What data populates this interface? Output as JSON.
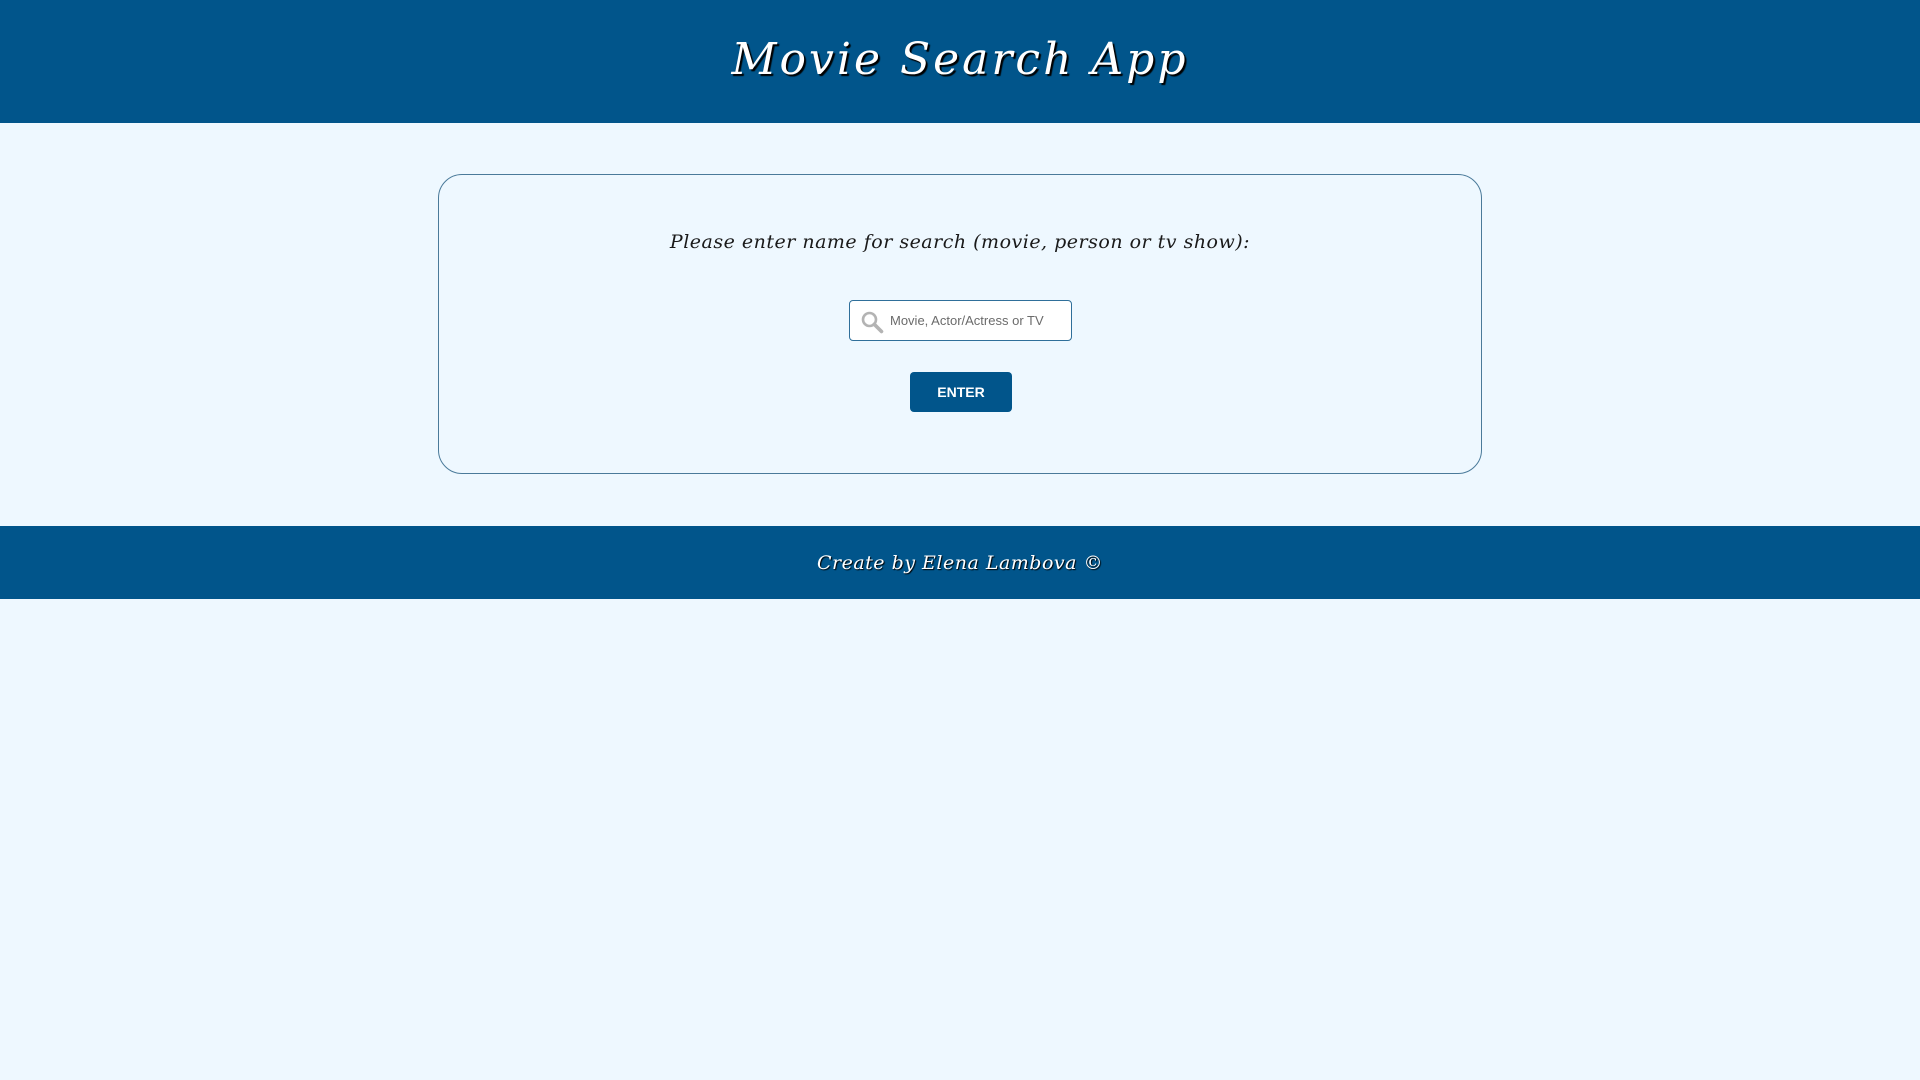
{
  "header": {
    "title": "Movie Search App"
  },
  "search": {
    "prompt": "Please enter name for search (movie, person or tv show):",
    "placeholder": "Movie, Actor/Actress or TV",
    "value": "",
    "icon": "search-icon",
    "button_label": "ENTER"
  },
  "footer": {
    "credit": "Create by Elena Lambova ©"
  },
  "colors": {
    "brand": "#01558b",
    "background": "#eef8ff"
  }
}
